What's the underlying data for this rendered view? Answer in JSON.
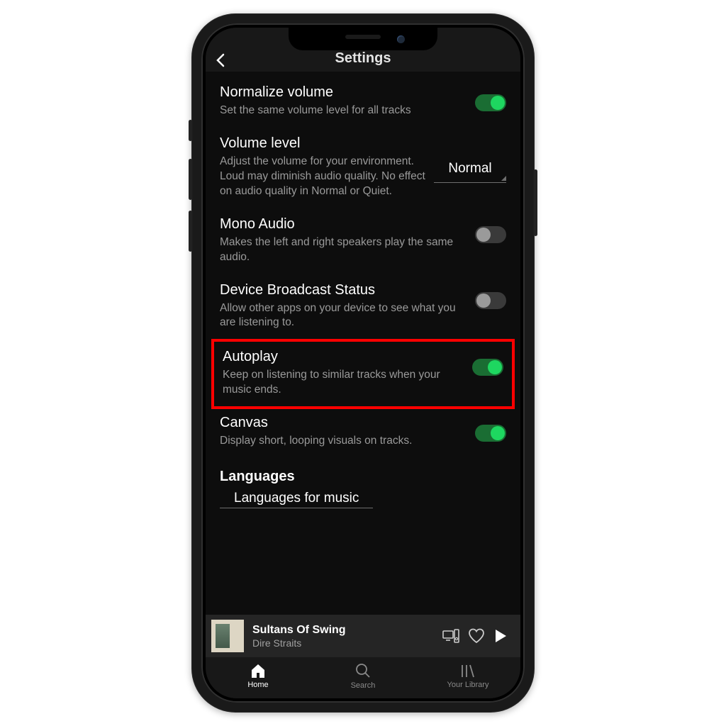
{
  "header": {
    "title": "Settings"
  },
  "settings": {
    "normalize": {
      "title": "Normalize volume",
      "desc": "Set the same volume level for all tracks",
      "on": true
    },
    "volume_level": {
      "title": "Volume level",
      "desc": "Adjust the volume for your environment. Loud may diminish audio quality. No effect on audio quality in Normal or Quiet.",
      "value": "Normal"
    },
    "mono": {
      "title": "Mono Audio",
      "desc": "Makes the left and right speakers play the same audio.",
      "on": false
    },
    "broadcast": {
      "title": "Device Broadcast Status",
      "desc": "Allow other apps on your device to see what you are listening to.",
      "on": false
    },
    "autoplay": {
      "title": "Autoplay",
      "desc": "Keep on listening to similar tracks when your music ends.",
      "on": true
    },
    "canvas": {
      "title": "Canvas",
      "desc": "Display short, looping visuals on tracks.",
      "on": true
    }
  },
  "languages": {
    "section": "Languages",
    "music_title": "Languages for music"
  },
  "nowplaying": {
    "song": "Sultans Of Swing",
    "artist": "Dire Straits"
  },
  "tabs": {
    "home": "Home",
    "search": "Search",
    "library": "Your Library"
  }
}
